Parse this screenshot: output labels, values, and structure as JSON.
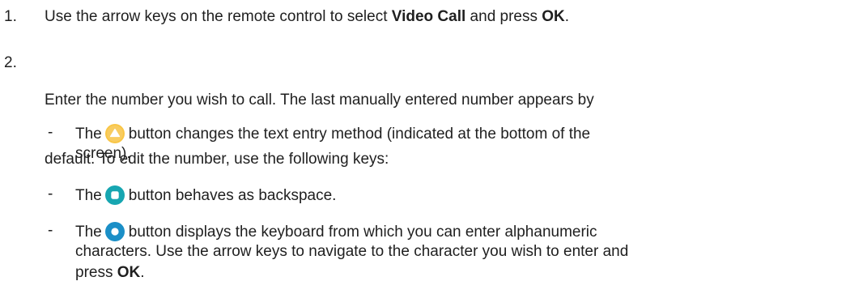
{
  "steps": [
    {
      "number": "1.",
      "parts": {
        "a": "Use the arrow keys on the remote control to select ",
        "b": "Video Call",
        "c": " and press ",
        "d": "OK",
        "e": "."
      }
    },
    {
      "number": "2.",
      "line1": "Enter the number you wish to call. The last manually entered number appears by",
      "line2": "default. To edit the number, use the following keys:"
    }
  ],
  "bullets": [
    {
      "dash": "-",
      "prefix": "The",
      "icon": "yellow-triangle-button-icon",
      "line1": "button changes the text entry method (indicated at the bottom of the",
      "line2": "screen)."
    },
    {
      "dash": "-",
      "prefix": "The",
      "icon": "teal-square-button-icon",
      "line1": "button behaves as backspace."
    },
    {
      "dash": "-",
      "prefix": "The",
      "icon": "blue-circle-button-icon",
      "line1": "button displays the keyboard from which you can enter alphanumeric",
      "line2": "characters. Use the arrow keys to navigate to the character you wish to enter and",
      "line3_a": "press ",
      "line3_b": "OK",
      "line3_c": "."
    }
  ],
  "colors": {
    "text": "#1f1f1f",
    "yellow_button": "#f6c24a",
    "teal_button": "#1aa5b0",
    "blue_button": "#1b8fc7"
  }
}
